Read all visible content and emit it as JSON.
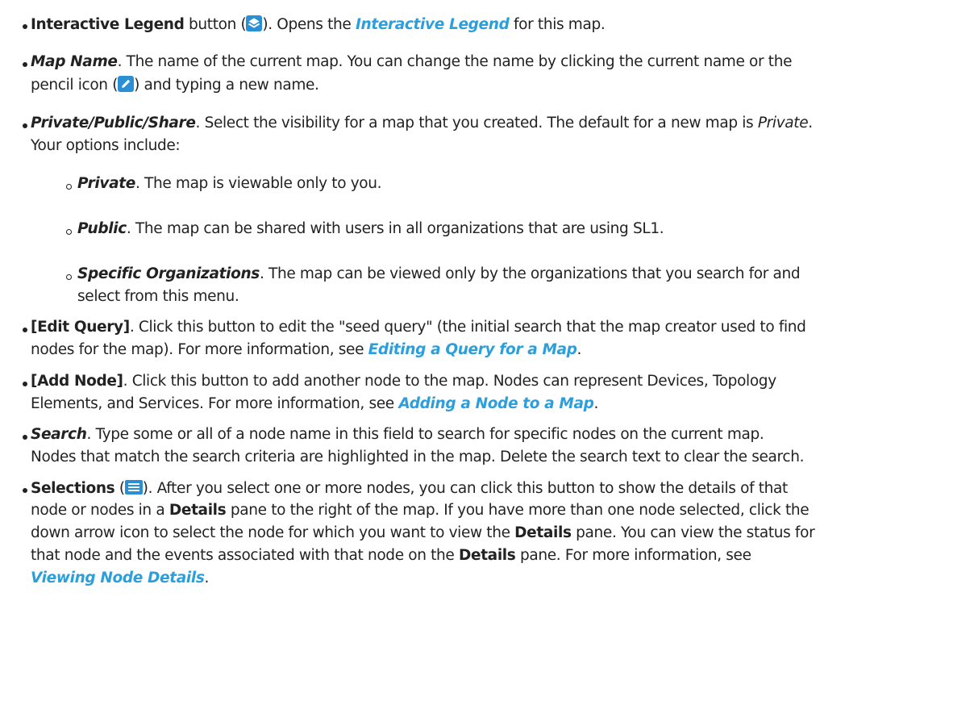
{
  "items": [
    {
      "lines": [
        [
          {
            "t": "Interactive Legend",
            "s": "b"
          },
          {
            "t": " button ("
          },
          {
            "icon": "legend-layers-icon"
          },
          {
            "t": "). Opens the "
          },
          {
            "t": "Interactive Legend",
            "s": "link"
          },
          {
            "t": " for this map."
          }
        ]
      ]
    },
    {
      "lines": [
        [
          {
            "t": "Map Name",
            "s": "bi"
          },
          {
            "t": ". The name of the current map. You can change the name by clicking the current name or the"
          }
        ],
        [
          {
            "t": "pencil icon ("
          },
          {
            "icon": "pencil-icon"
          },
          {
            "t": ") and typing a new name."
          }
        ]
      ]
    },
    {
      "lines": [
        [
          {
            "t": "Private/Public/Share",
            "s": "bi"
          },
          {
            "t": ". Select the visibility for a map that you created. The default for a new map is "
          },
          {
            "t": "Private",
            "s": "i"
          },
          {
            "t": "."
          }
        ],
        [
          {
            "t": "Your options include:"
          }
        ]
      ]
    },
    {
      "sub": true,
      "lines": [
        [
          {
            "t": "Private",
            "s": "bi"
          },
          {
            "t": ". The map is viewable only to you."
          }
        ]
      ]
    },
    {
      "sub": true,
      "lines": [
        [
          {
            "t": "Public",
            "s": "bi"
          },
          {
            "t": ". The map can be shared with users in all organizations that are using SL1."
          }
        ]
      ]
    },
    {
      "sub": true,
      "lines": [
        [
          {
            "t": "Specific Organizations",
            "s": "bi"
          },
          {
            "t": ". The map can be viewed only by the organizations that you search for and"
          }
        ],
        [
          {
            "t": "select from this menu."
          }
        ]
      ]
    },
    {
      "lines": [
        [
          {
            "t": "[Edit Query]",
            "s": "b"
          },
          {
            "t": ". Click this button to edit the \"seed query\" (the initial search that the map creator used to find"
          }
        ],
        [
          {
            "t": "nodes for the map). For more information, see "
          },
          {
            "t": "Editing a Query for a Map",
            "s": "link"
          },
          {
            "t": "."
          }
        ]
      ]
    },
    {
      "lines": [
        [
          {
            "t": "[Add Node]",
            "s": "b"
          },
          {
            "t": ". Click this button to add another node to the map. Nodes can represent Devices, Topology"
          }
        ],
        [
          {
            "t": "Elements, and Services. For more information, see "
          },
          {
            "t": "Adding a Node to a Map",
            "s": "link"
          },
          {
            "t": "."
          }
        ]
      ]
    },
    {
      "lines": [
        [
          {
            "t": "Search",
            "s": "bi"
          },
          {
            "t": ". Type some or all of a node name in this field to search for specific nodes on the current map."
          }
        ],
        [
          {
            "t": "Nodes that match the search criteria are highlighted in the map. Delete the search text to clear the search."
          }
        ]
      ]
    },
    {
      "lines": [
        [
          {
            "t": "Selections",
            "s": "b"
          },
          {
            "t": " ("
          },
          {
            "icon": "selections-list-icon"
          },
          {
            "t": "). After you select one or more nodes, you can click this button to show the details of that"
          }
        ],
        [
          {
            "t": "node or nodes in a "
          },
          {
            "t": "Details",
            "s": "b"
          },
          {
            "t": " pane to the right of the map. If you have more than one node selected, click the"
          }
        ],
        [
          {
            "t": "down arrow icon to select the node for which you want to view the "
          },
          {
            "t": "Details",
            "s": "b"
          },
          {
            "t": " pane. You can view the status for"
          }
        ],
        [
          {
            "t": "that node and the events associated with that node on the "
          },
          {
            "t": "Details",
            "s": "b"
          },
          {
            "t": " pane. For more information, see"
          }
        ],
        [
          {
            "t": "Viewing Node Details",
            "s": "link"
          },
          {
            "t": "."
          }
        ]
      ]
    }
  ],
  "colors": {
    "text": "#222222",
    "link": "#2b9fdc",
    "icon_blue": "#2b8fd6"
  }
}
